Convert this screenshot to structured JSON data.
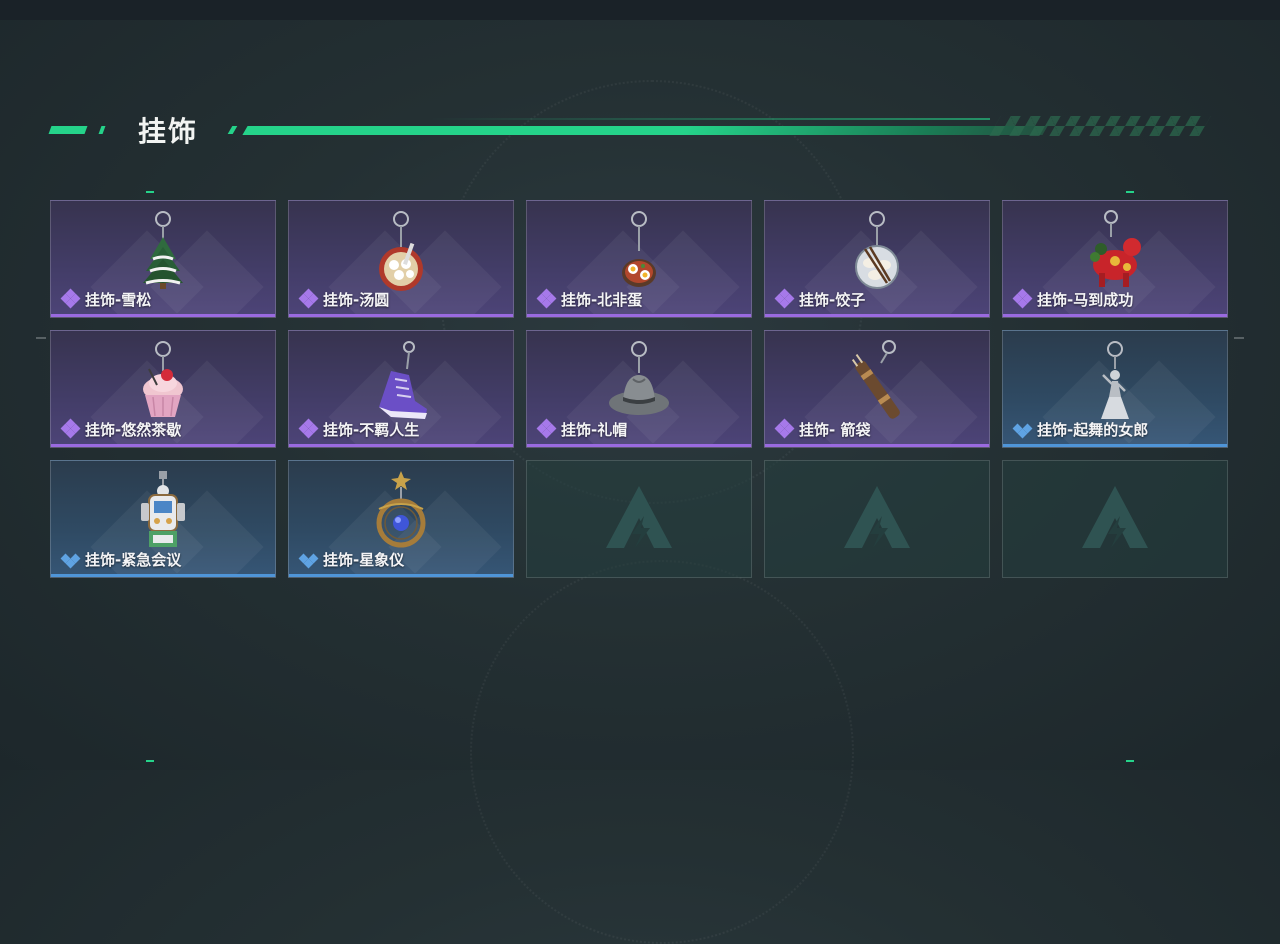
{
  "section": {
    "title": "挂饰"
  },
  "colors": {
    "accent": "#25d38a",
    "purple_rarity": "#9a6ae0",
    "blue_rarity": "#4f95d8"
  },
  "items": [
    {
      "name": "挂饰-雪松",
      "rarity": "purple",
      "icon": "snow-pine-tree-charm-icon"
    },
    {
      "name": "挂饰-汤圆",
      "rarity": "purple",
      "icon": "tangyuan-bowl-charm-icon"
    },
    {
      "name": "挂饰-北非蛋",
      "rarity": "purple",
      "icon": "shakshuka-charm-icon"
    },
    {
      "name": "挂饰-饺子",
      "rarity": "purple",
      "icon": "dumplings-plate-charm-icon"
    },
    {
      "name": "挂饰-马到成功",
      "rarity": "purple",
      "icon": "red-horse-charm-icon"
    },
    {
      "name": "挂饰-悠然茶歇",
      "rarity": "purple",
      "icon": "cupcake-charm-icon"
    },
    {
      "name": "挂饰-不羁人生",
      "rarity": "purple",
      "icon": "purple-sneaker-charm-icon"
    },
    {
      "name": "挂饰-礼帽",
      "rarity": "purple",
      "icon": "fedora-hat-charm-icon"
    },
    {
      "name": "挂饰- 箭袋",
      "rarity": "purple",
      "icon": "quiver-charm-icon"
    },
    {
      "name": "挂饰-起舞的女郎",
      "rarity": "blue",
      "icon": "dancing-lady-charm-icon"
    },
    {
      "name": "挂饰-紧急会议",
      "rarity": "blue",
      "icon": "emergency-meeting-charm-icon"
    },
    {
      "name": "挂饰-星象仪",
      "rarity": "blue",
      "icon": "astrolabe-charm-icon"
    }
  ],
  "empty_slots": 3
}
